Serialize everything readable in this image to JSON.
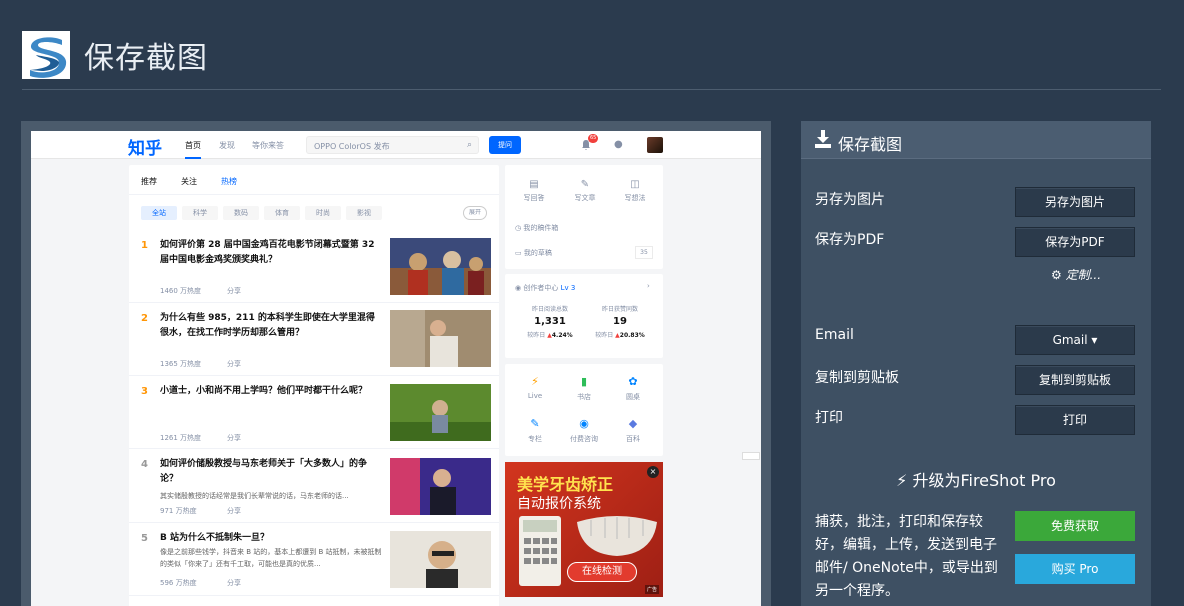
{
  "app": {
    "title": "保存截图"
  },
  "preview": {
    "nav": {
      "logo": "知乎",
      "items": [
        "首页",
        "发现",
        "等你来答"
      ],
      "search_placeholder": "OPPO ColorOS 发布",
      "ask_button": "提问",
      "badge": "65"
    },
    "feed_tabs": [
      "推荐",
      "关注",
      "热榜"
    ],
    "chips": [
      "全站",
      "科学",
      "数码",
      "体育",
      "时尚",
      "影视"
    ],
    "chip_expand": "展开",
    "items": [
      {
        "rank": "1",
        "question": "如何评价第 28 届中国金鸡百花电影节闭幕式暨第 32 届中国电影金鸡奖颁奖典礼？",
        "excerpt": "",
        "heat": "1460 万热度",
        "share": "分享"
      },
      {
        "rank": "2",
        "question": "为什么有些 985，211 的本科学生即使在大学里混得很水，在找工作时学历却那么管用？",
        "excerpt": "",
        "heat": "1365 万热度",
        "share": "分享"
      },
      {
        "rank": "3",
        "question": "小道士，小和尚不用上学吗？他们平时都干什么呢？",
        "excerpt": "",
        "heat": "1261 万热度",
        "share": "分享"
      },
      {
        "rank": "4",
        "question": "如何评价储殷教授与马东老师关于「大多数人」的争论？",
        "excerpt": "其实储殷教授的话经常是我们长辈常说的话，马东老师的话...",
        "heat": "971 万热度",
        "share": "分享"
      },
      {
        "rank": "5",
        "question": "B 站为什么不抵制朱一旦？",
        "excerpt": "像是之前那些钱学，抖音来 B 站的，基本上都遭到 B 站抵制，未被抵制的类似「你来了」还有千工取，可能也是真的优质...",
        "heat": "596 万热度",
        "share": "分享"
      }
    ],
    "right": {
      "actions": [
        "写回答",
        "写文章",
        "写想法"
      ],
      "drafts": "我的稿件箱",
      "collections": "我的草稿",
      "collections_count": "35",
      "creator": "创作者中心",
      "level": "Lv 3",
      "stats": [
        {
          "label": "昨日阅读总数",
          "value": "1,331",
          "delta_label": "较昨日",
          "delta": "4.24%"
        },
        {
          "label": "昨日获赞同数",
          "value": "19",
          "delta_label": "较昨日",
          "delta": "20.83%"
        }
      ],
      "tools": [
        "Live",
        "书店",
        "圆桌",
        "专栏",
        "付费咨询",
        "百科"
      ]
    },
    "ad": {
      "line1": "美学牙齿矫正",
      "line2": "自动报价系统",
      "button": "在线检测",
      "tag": "广告"
    }
  },
  "panel": {
    "title": "保存截图",
    "rows": [
      {
        "label": "另存为图片",
        "button": "另存为图片"
      },
      {
        "label": "保存为PDF",
        "button": "保存为PDF"
      }
    ],
    "custom": "定制...",
    "email_label": "Email",
    "email_button": "Gmail",
    "clipboard_label": "复制到剪贴板",
    "clipboard_button": "复制到剪贴板",
    "print_label": "打印",
    "print_button": "打印",
    "pro_heading": "升级为FireShot Pro",
    "pro_text": "捕获，批注，打印和保存较好，编辑，上传，发送到电子邮件/ OneNote中，或导出到另一个程序。",
    "free_button": "免费获取",
    "buy_button": "购买 Pro"
  },
  "colors": {
    "background": "#2b3b4e",
    "panel": "#3e5063",
    "zhihu_blue": "#0066ff",
    "green": "#3ba83a",
    "blue": "#29a8dc"
  }
}
